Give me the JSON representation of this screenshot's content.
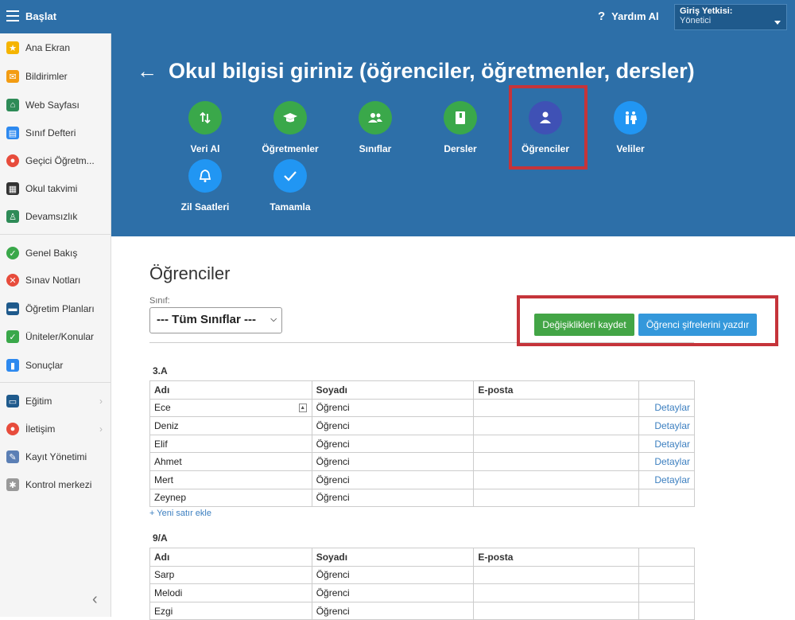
{
  "topbar": {
    "start_label": "Başlat",
    "help_label": "Yardım Al",
    "auth_title": "Giriş Yetkisi:",
    "auth_value": "Yönetici"
  },
  "sidebar": {
    "items": [
      {
        "label": "Ana Ekran",
        "icon": "star-icon",
        "color": "#f5b400"
      },
      {
        "label": "Bildirimler",
        "icon": "envelope-icon",
        "color": "#f39c12"
      },
      {
        "label": "Web Sayfası",
        "icon": "home-icon",
        "color": "#2e8b57"
      },
      {
        "label": "Sınıf Defteri",
        "icon": "notebook-icon",
        "color": "#2d89ef"
      },
      {
        "label": "Geçici Öğretm...",
        "icon": "substitute-teacher-icon",
        "color": "#e74c3c"
      },
      {
        "label": "Okul takvimi",
        "icon": "calendar-icon",
        "color": "#333333"
      },
      {
        "label": "Devamsızlık",
        "icon": "attendance-icon",
        "color": "#2e8b57"
      },
      {
        "label": "Genel Bakış",
        "icon": "check-circle-icon",
        "color": "#3aa84a"
      },
      {
        "label": "Sınav Notları",
        "icon": "grades-icon",
        "color": "#e74c3c"
      },
      {
        "label": "Öğretim Planları",
        "icon": "briefcase-icon",
        "color": "#1f5a8c"
      },
      {
        "label": "Üniteler/Konular",
        "icon": "shield-check-icon",
        "color": "#3aa84a"
      },
      {
        "label": "Sonuçlar",
        "icon": "bar-chart-icon",
        "color": "#2d89ef"
      },
      {
        "label": "Eğitim",
        "icon": "book-icon",
        "color": "#1f5a8c"
      },
      {
        "label": "İletişim",
        "icon": "chat-icon",
        "color": "#e74c3c"
      },
      {
        "label": "Kayıt Yönetimi",
        "icon": "pen-icon",
        "color": "#5b7fb5"
      },
      {
        "label": "Kontrol merkezi",
        "icon": "gear-icon",
        "color": "#999999"
      }
    ]
  },
  "hero": {
    "title": "Okul bilgisi giriniz (öğrenciler, öğretmenler, dersler)",
    "steps": [
      {
        "label": "Veri Al",
        "icon": "import-arrows-icon"
      },
      {
        "label": "Öğretmenler",
        "icon": "graduation-cap-icon"
      },
      {
        "label": "Sınıflar",
        "icon": "people-icon"
      },
      {
        "label": "Dersler",
        "icon": "book-icon"
      },
      {
        "label": "Öğrenciler",
        "icon": "person-icon"
      },
      {
        "label": "Veliler",
        "icon": "parents-icon"
      },
      {
        "label": "Zil Saatleri",
        "icon": "bell-icon"
      },
      {
        "label": "Tamamla",
        "icon": "checkmark-icon"
      }
    ]
  },
  "content": {
    "section_title": "Öğrenciler",
    "class_label": "Sınıf:",
    "class_select_value": "--- Tüm Sınıflar ---",
    "save_button": "Değişiklikleri kaydet",
    "print_button": "Öğrenci şifrelerini yazdır",
    "add_row_label": "+ Yeni satır ekle",
    "columns": {
      "first": "Adı",
      "last": "Soyadı",
      "email": "E-posta"
    },
    "groups": [
      {
        "title": "3.A",
        "rows": [
          {
            "first": "Ece",
            "last": "Öğrenci",
            "email": "",
            "action": "Detaylar"
          },
          {
            "first": "Deniz",
            "last": "Öğrenci",
            "email": "",
            "action": "Detaylar"
          },
          {
            "first": "Elif",
            "last": "Öğrenci",
            "email": "",
            "action": "Detaylar"
          },
          {
            "first": "Ahmet",
            "last": "Öğrenci",
            "email": "",
            "action": "Detaylar"
          },
          {
            "first": "Mert",
            "last": "Öğrenci",
            "email": "",
            "action": "Detaylar"
          },
          {
            "first": "Zeynep",
            "last": "Öğrenci",
            "email": "",
            "action": ""
          }
        ]
      },
      {
        "title": "9/A",
        "rows": [
          {
            "first": "Sarp",
            "last": "Öğrenci",
            "email": "",
            "action": ""
          },
          {
            "first": "Melodi",
            "last": "Öğrenci",
            "email": "",
            "action": ""
          },
          {
            "first": "Ezgi",
            "last": "Öğrenci",
            "email": "",
            "action": ""
          }
        ]
      }
    ]
  }
}
